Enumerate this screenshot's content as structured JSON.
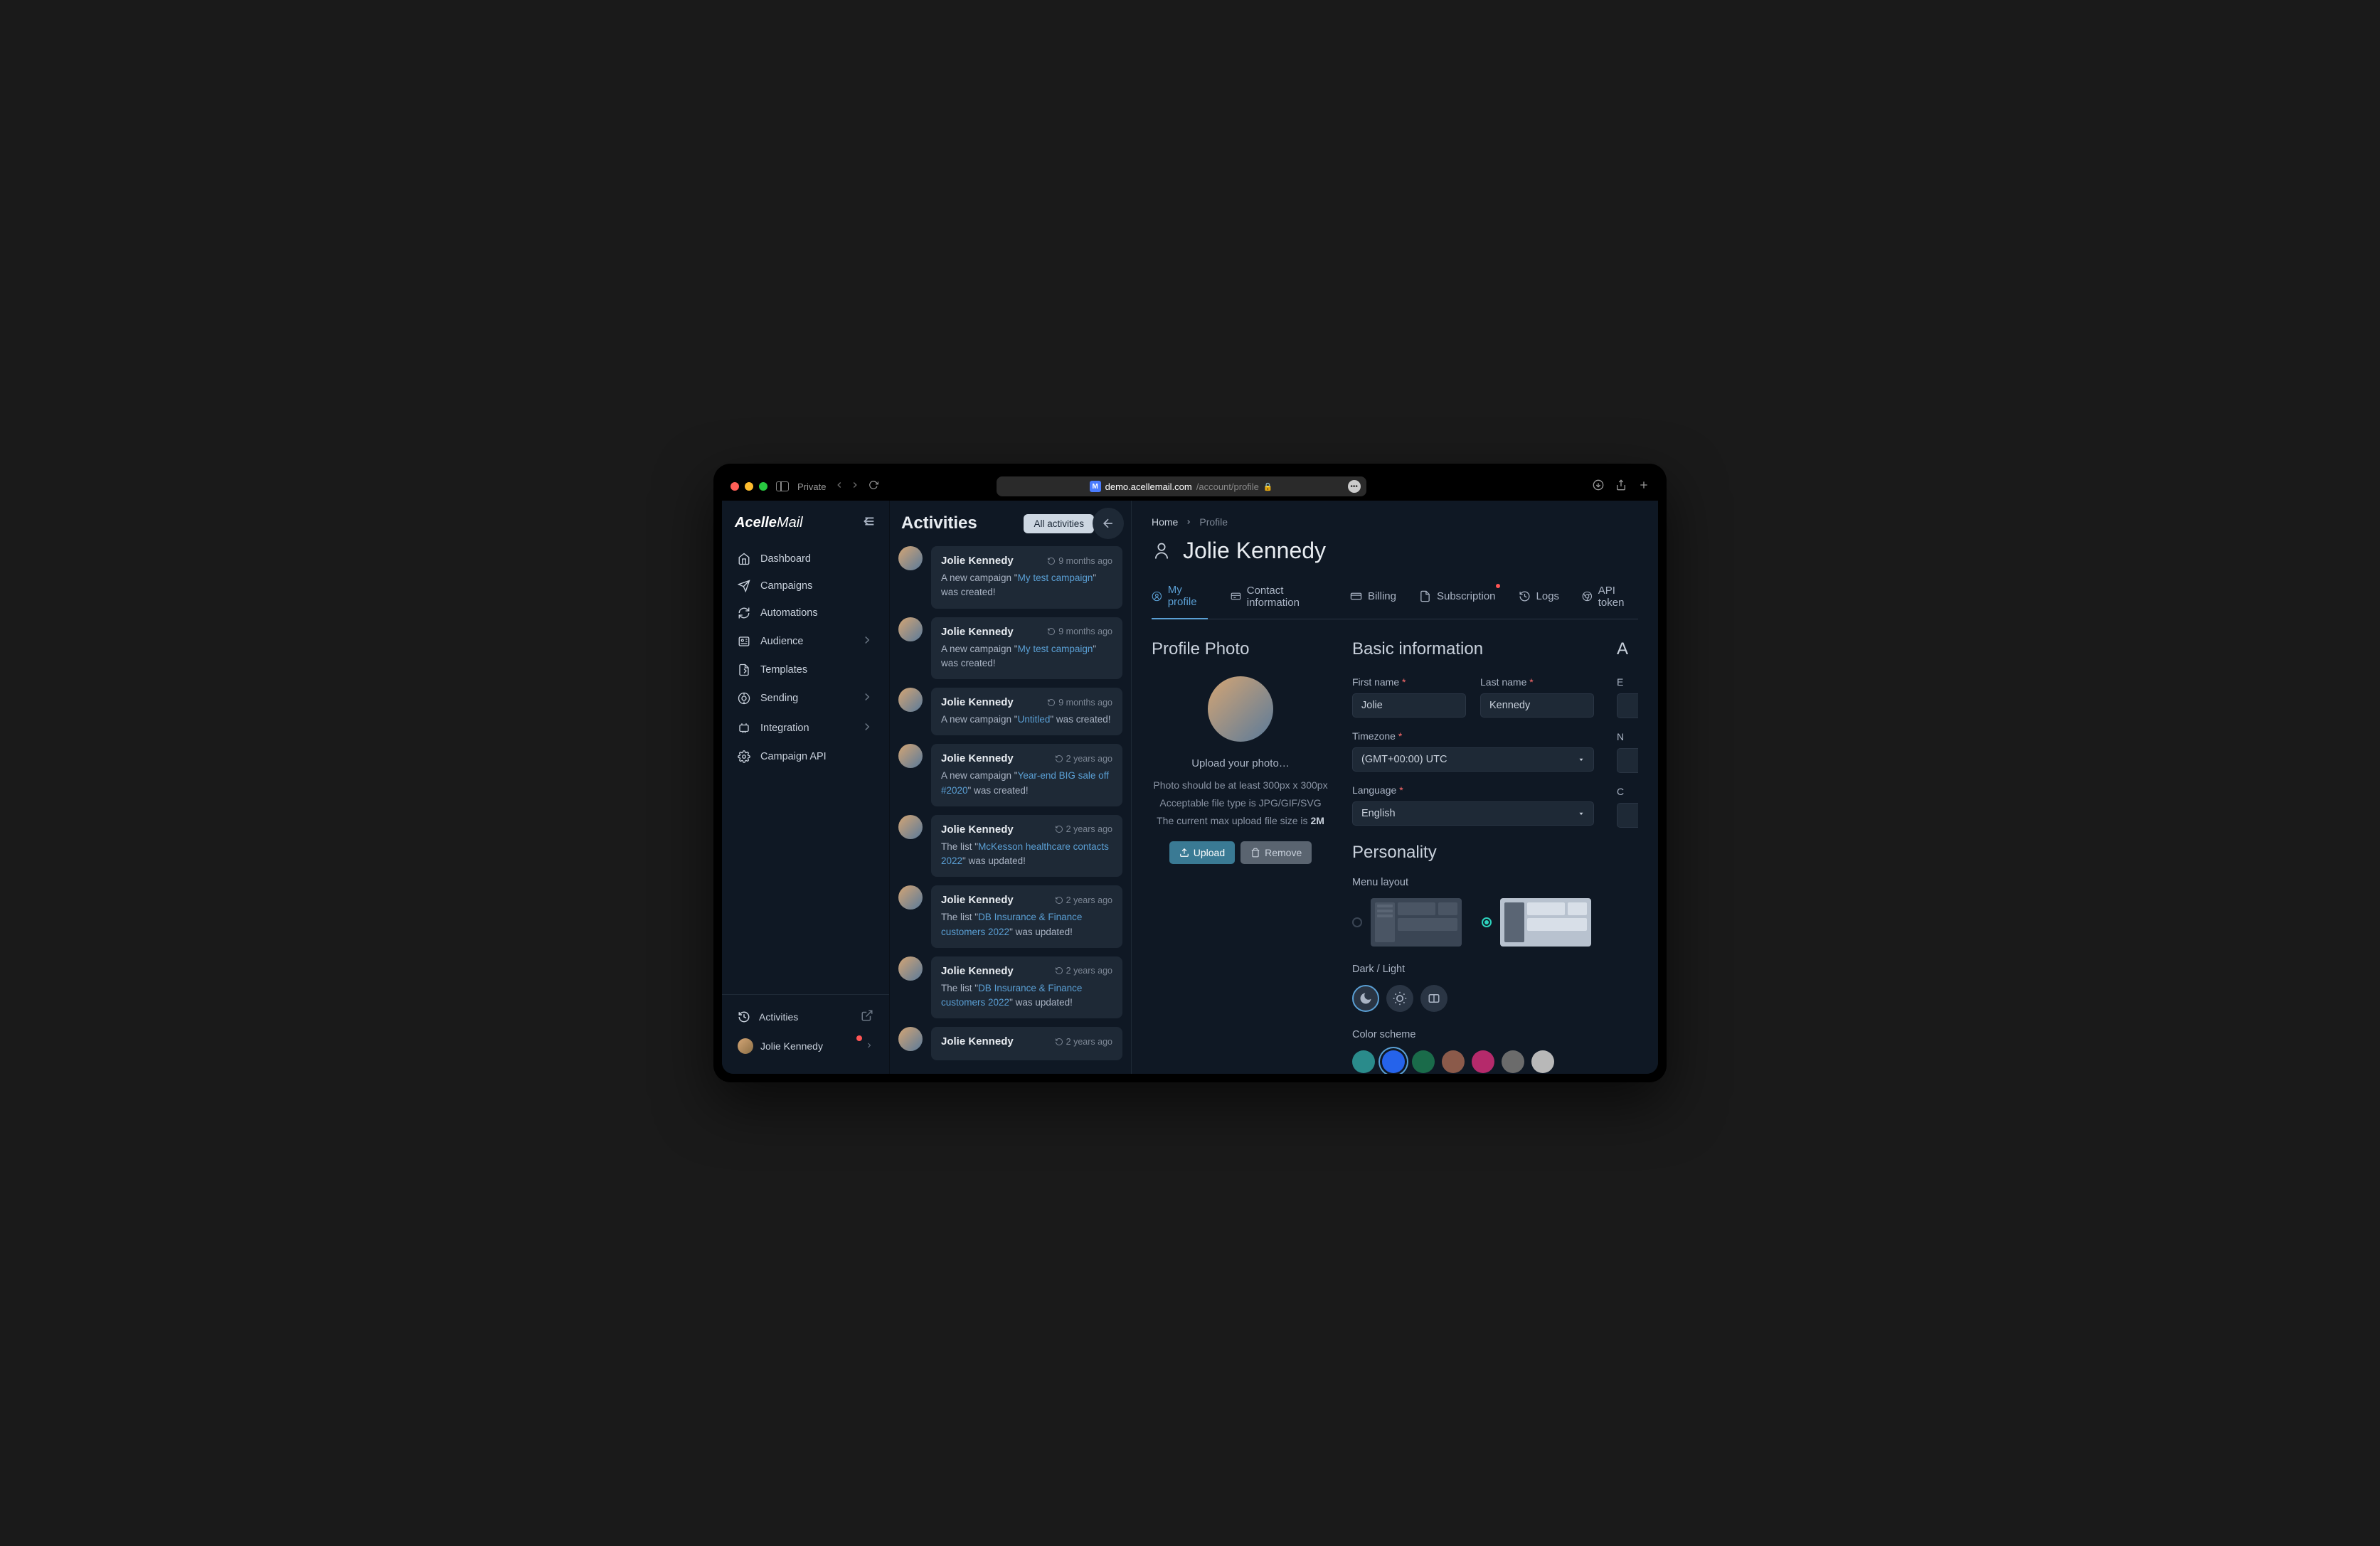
{
  "browser": {
    "private_label": "Private",
    "favicon_letter": "M",
    "url_domain": "demo.acellemail.com",
    "url_path": "/account/profile"
  },
  "sidebar": {
    "logo_primary": "Acelle",
    "logo_secondary": "Mail",
    "items": [
      {
        "label": "Dashboard",
        "icon": "home"
      },
      {
        "label": "Campaigns",
        "icon": "send"
      },
      {
        "label": "Automations",
        "icon": "refresh"
      },
      {
        "label": "Audience",
        "icon": "users",
        "expandable": true
      },
      {
        "label": "Templates",
        "icon": "file"
      },
      {
        "label": "Sending",
        "icon": "target",
        "expandable": true
      },
      {
        "label": "Integration",
        "icon": "plug",
        "expandable": true
      },
      {
        "label": "Campaign API",
        "icon": "gear"
      }
    ],
    "footer_activities": "Activities",
    "footer_user": "Jolie Kennedy"
  },
  "activities": {
    "title": "Activities",
    "all_button": "All activities",
    "items": [
      {
        "user": "Jolie Kennedy",
        "time": "9 months ago",
        "prefix": "A new campaign \"",
        "link": "My test campaign",
        "suffix": "\" was created!"
      },
      {
        "user": "Jolie Kennedy",
        "time": "9 months ago",
        "prefix": "A new campaign \"",
        "link": "My test campaign",
        "suffix": "\" was created!"
      },
      {
        "user": "Jolie Kennedy",
        "time": "9 months ago",
        "prefix": "A new campaign \"",
        "link": "Untitled",
        "suffix": "\" was created!"
      },
      {
        "user": "Jolie Kennedy",
        "time": "2 years ago",
        "prefix": "A new campaign \"",
        "link": "Year-end BIG sale off #2020",
        "suffix": "\" was created!"
      },
      {
        "user": "Jolie Kennedy",
        "time": "2 years ago",
        "prefix": "The list \"",
        "link": "McKesson healthcare contacts 2022",
        "suffix": "\" was updated!"
      },
      {
        "user": "Jolie Kennedy",
        "time": "2 years ago",
        "prefix": "The list \"",
        "link": "DB Insurance & Finance customers 2022",
        "suffix": "\" was updated!"
      },
      {
        "user": "Jolie Kennedy",
        "time": "2 years ago",
        "prefix": "The list \"",
        "link": "DB Insurance & Finance customers 2022",
        "suffix": "\" was updated!"
      },
      {
        "user": "Jolie Kennedy",
        "time": "2 years ago",
        "prefix": "",
        "link": "",
        "suffix": ""
      }
    ]
  },
  "main": {
    "breadcrumb_home": "Home",
    "breadcrumb_current": "Profile",
    "page_title": "Jolie Kennedy",
    "tabs": [
      {
        "label": "My profile",
        "active": true
      },
      {
        "label": "Contact information"
      },
      {
        "label": "Billing"
      },
      {
        "label": "Subscription",
        "alert": true
      },
      {
        "label": "Logs"
      },
      {
        "label": "API token"
      }
    ],
    "photo": {
      "title": "Profile Photo",
      "upload_prompt": "Upload your photo…",
      "hint_size": "Photo should be at least 300px x 300px",
      "hint_type": "Acceptable file type is JPG/GIF/SVG",
      "hint_max_prefix": "The current max upload file size is ",
      "hint_max_value": "2M",
      "btn_upload": "Upload",
      "btn_remove": "Remove"
    },
    "form": {
      "basic_title": "Basic information",
      "first_name_label": "First name",
      "first_name_value": "Jolie",
      "last_name_label": "Last name",
      "last_name_value": "Kennedy",
      "timezone_label": "Timezone",
      "timezone_value": "(GMT+00:00) UTC",
      "language_label": "Language",
      "language_value": "English"
    },
    "personality": {
      "title": "Personality",
      "menu_layout_label": "Menu layout",
      "theme_label": "Dark / Light",
      "color_label": "Color scheme",
      "colors": [
        "#2a8b8b",
        "#2563eb",
        "#1a6b4a",
        "#8b5a4a",
        "#b52a6b",
        "#6b6b6b",
        "#b8b8b8"
      ],
      "active_color_index": 1
    },
    "extra": {
      "account_title": "A",
      "email_label": "E",
      "new_pw_label": "N",
      "confirm_label": "C"
    }
  }
}
